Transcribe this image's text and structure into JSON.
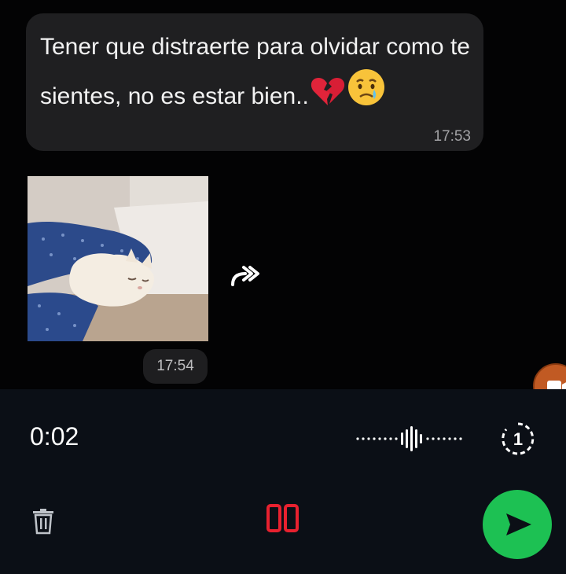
{
  "messages": [
    {
      "type": "text",
      "text_parts": [
        "Tener que distraerte para olvidar como te sientes, no es estar bien.."
      ],
      "emojis": [
        "broken-heart",
        "sad-but-relieved-face"
      ],
      "time": "17:53"
    },
    {
      "type": "image",
      "image_description": "white kitten lying under a blue blanket",
      "time": "17:54"
    }
  ],
  "recorder": {
    "elapsed": "0:02",
    "view_once_count": "1"
  },
  "colors": {
    "bubble": "#1f1f21",
    "send": "#1dc153",
    "pause": "#e8212f",
    "recorder_bg": "#0b0f16"
  },
  "icons": {
    "forward": "forward-icon",
    "trash": "trash-icon",
    "pause": "pause-icon",
    "send": "send-icon",
    "view_once": "view-once-icon",
    "video": "video-call-icon"
  }
}
